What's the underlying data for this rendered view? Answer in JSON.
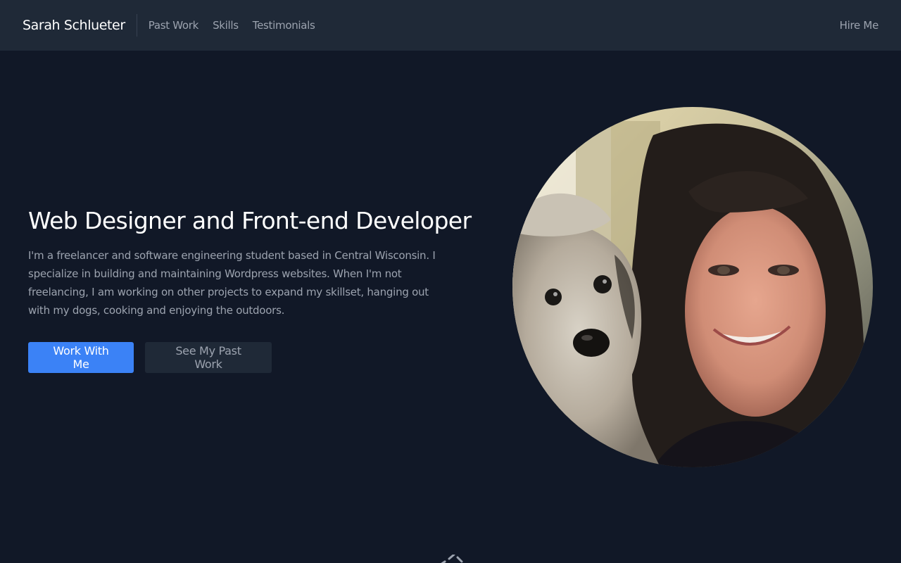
{
  "nav": {
    "brand": "Sarah Schlueter",
    "links": [
      "Past Work",
      "Skills",
      "Testimonials"
    ],
    "cta": "Hire Me"
  },
  "hero": {
    "title": "Web Designer and Front-end Developer",
    "description": "I'm a freelancer and software engineering student based in Central Wisconsin. I specialize in building and maintaining Wordpress websites. When I'm not freelancing, I am working on other projects to expand my skillset, hanging out with my dogs, cooking and enjoying the outdoors.",
    "primary_button": "Work With Me",
    "secondary_button": "See My Past Work"
  },
  "icons": {
    "portrait": "portrait-photo",
    "bottom": "code-icon"
  },
  "colors": {
    "background": "#111827",
    "navbar": "#1f2937",
    "accent": "#3b82f6",
    "muted_text": "#9ca3af"
  }
}
